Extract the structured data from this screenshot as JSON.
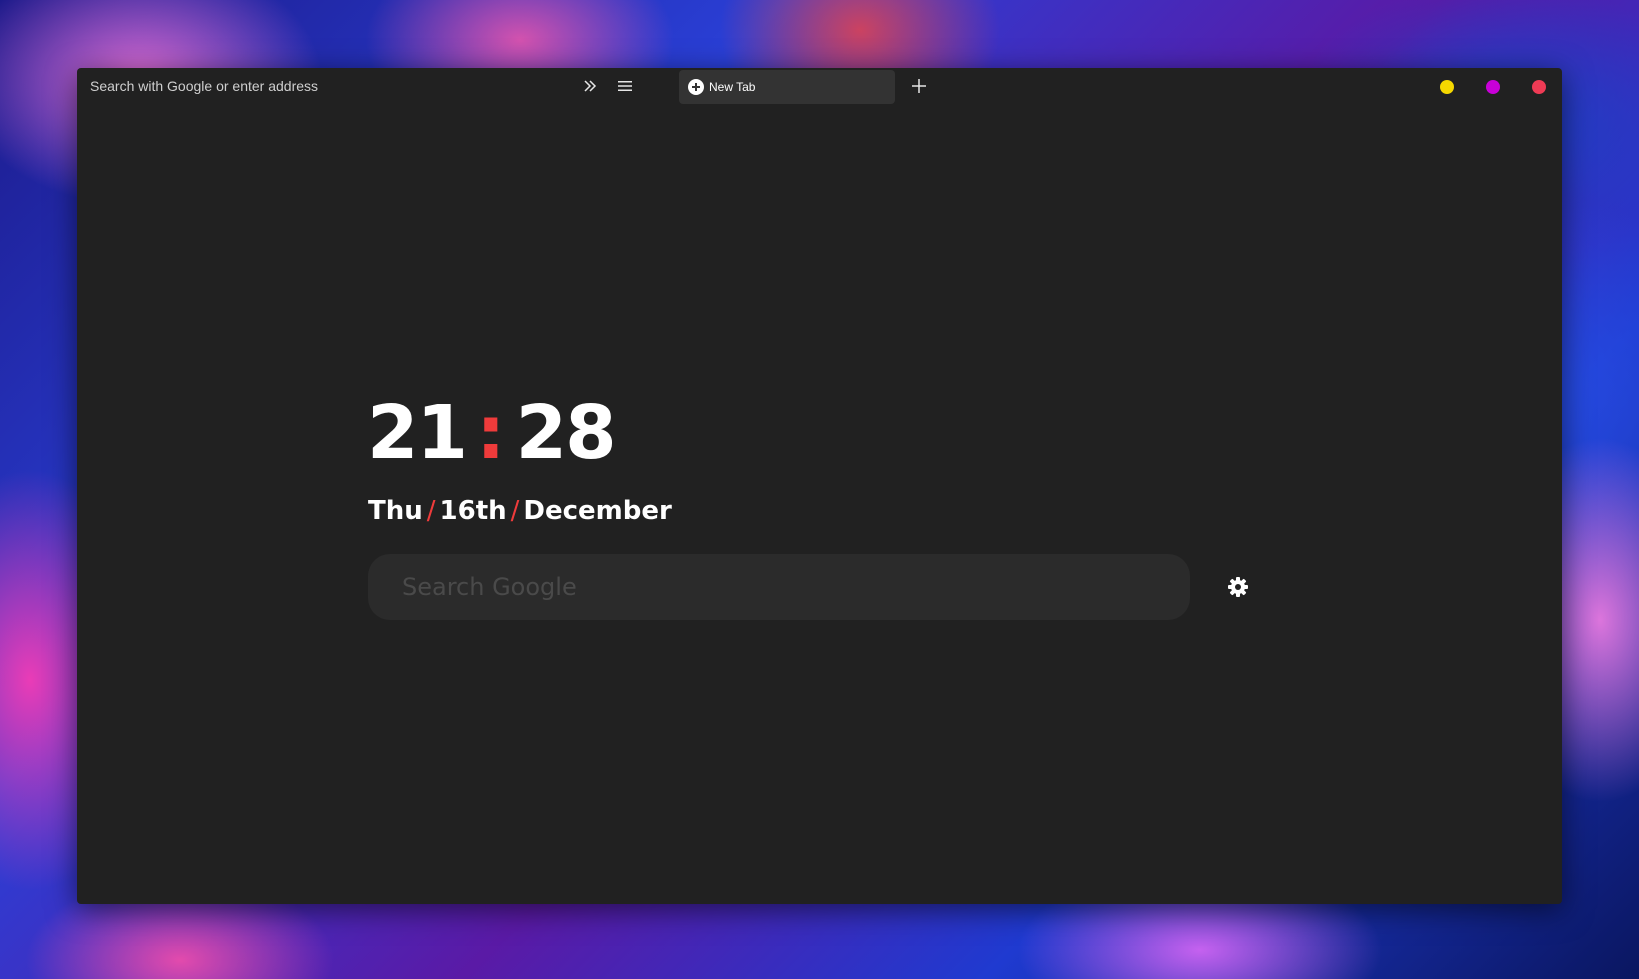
{
  "browser": {
    "address_bar": {
      "placeholder": "Search with Google or enter address",
      "value": ""
    },
    "toolbar": {
      "sidebar_icon": "double-chevron-right-icon",
      "menu_icon": "hamburger-menu-icon",
      "new_tab_icon": "plus-icon"
    },
    "tabs": [
      {
        "title": "New Tab",
        "icon": "plus-circle-icon",
        "active": true
      }
    ],
    "window_controls": [
      {
        "name": "minimize",
        "color": "#f5d800"
      },
      {
        "name": "maximize",
        "color": "#c800d8"
      },
      {
        "name": "close",
        "color": "#ef3b55"
      }
    ]
  },
  "page": {
    "clock": {
      "hours": "21",
      "separator": ":",
      "minutes": "28"
    },
    "date": {
      "day": "Thu",
      "separator": "/",
      "date": "16th",
      "month": "December"
    },
    "search": {
      "placeholder": "Search Google",
      "value": ""
    },
    "settings_icon": "gear-icon"
  },
  "colors": {
    "window_bg": "#212121",
    "tab_bg": "#333333",
    "search_bg": "#2b2b2b",
    "accent": "#ef3b3b",
    "text": "#ffffff"
  }
}
